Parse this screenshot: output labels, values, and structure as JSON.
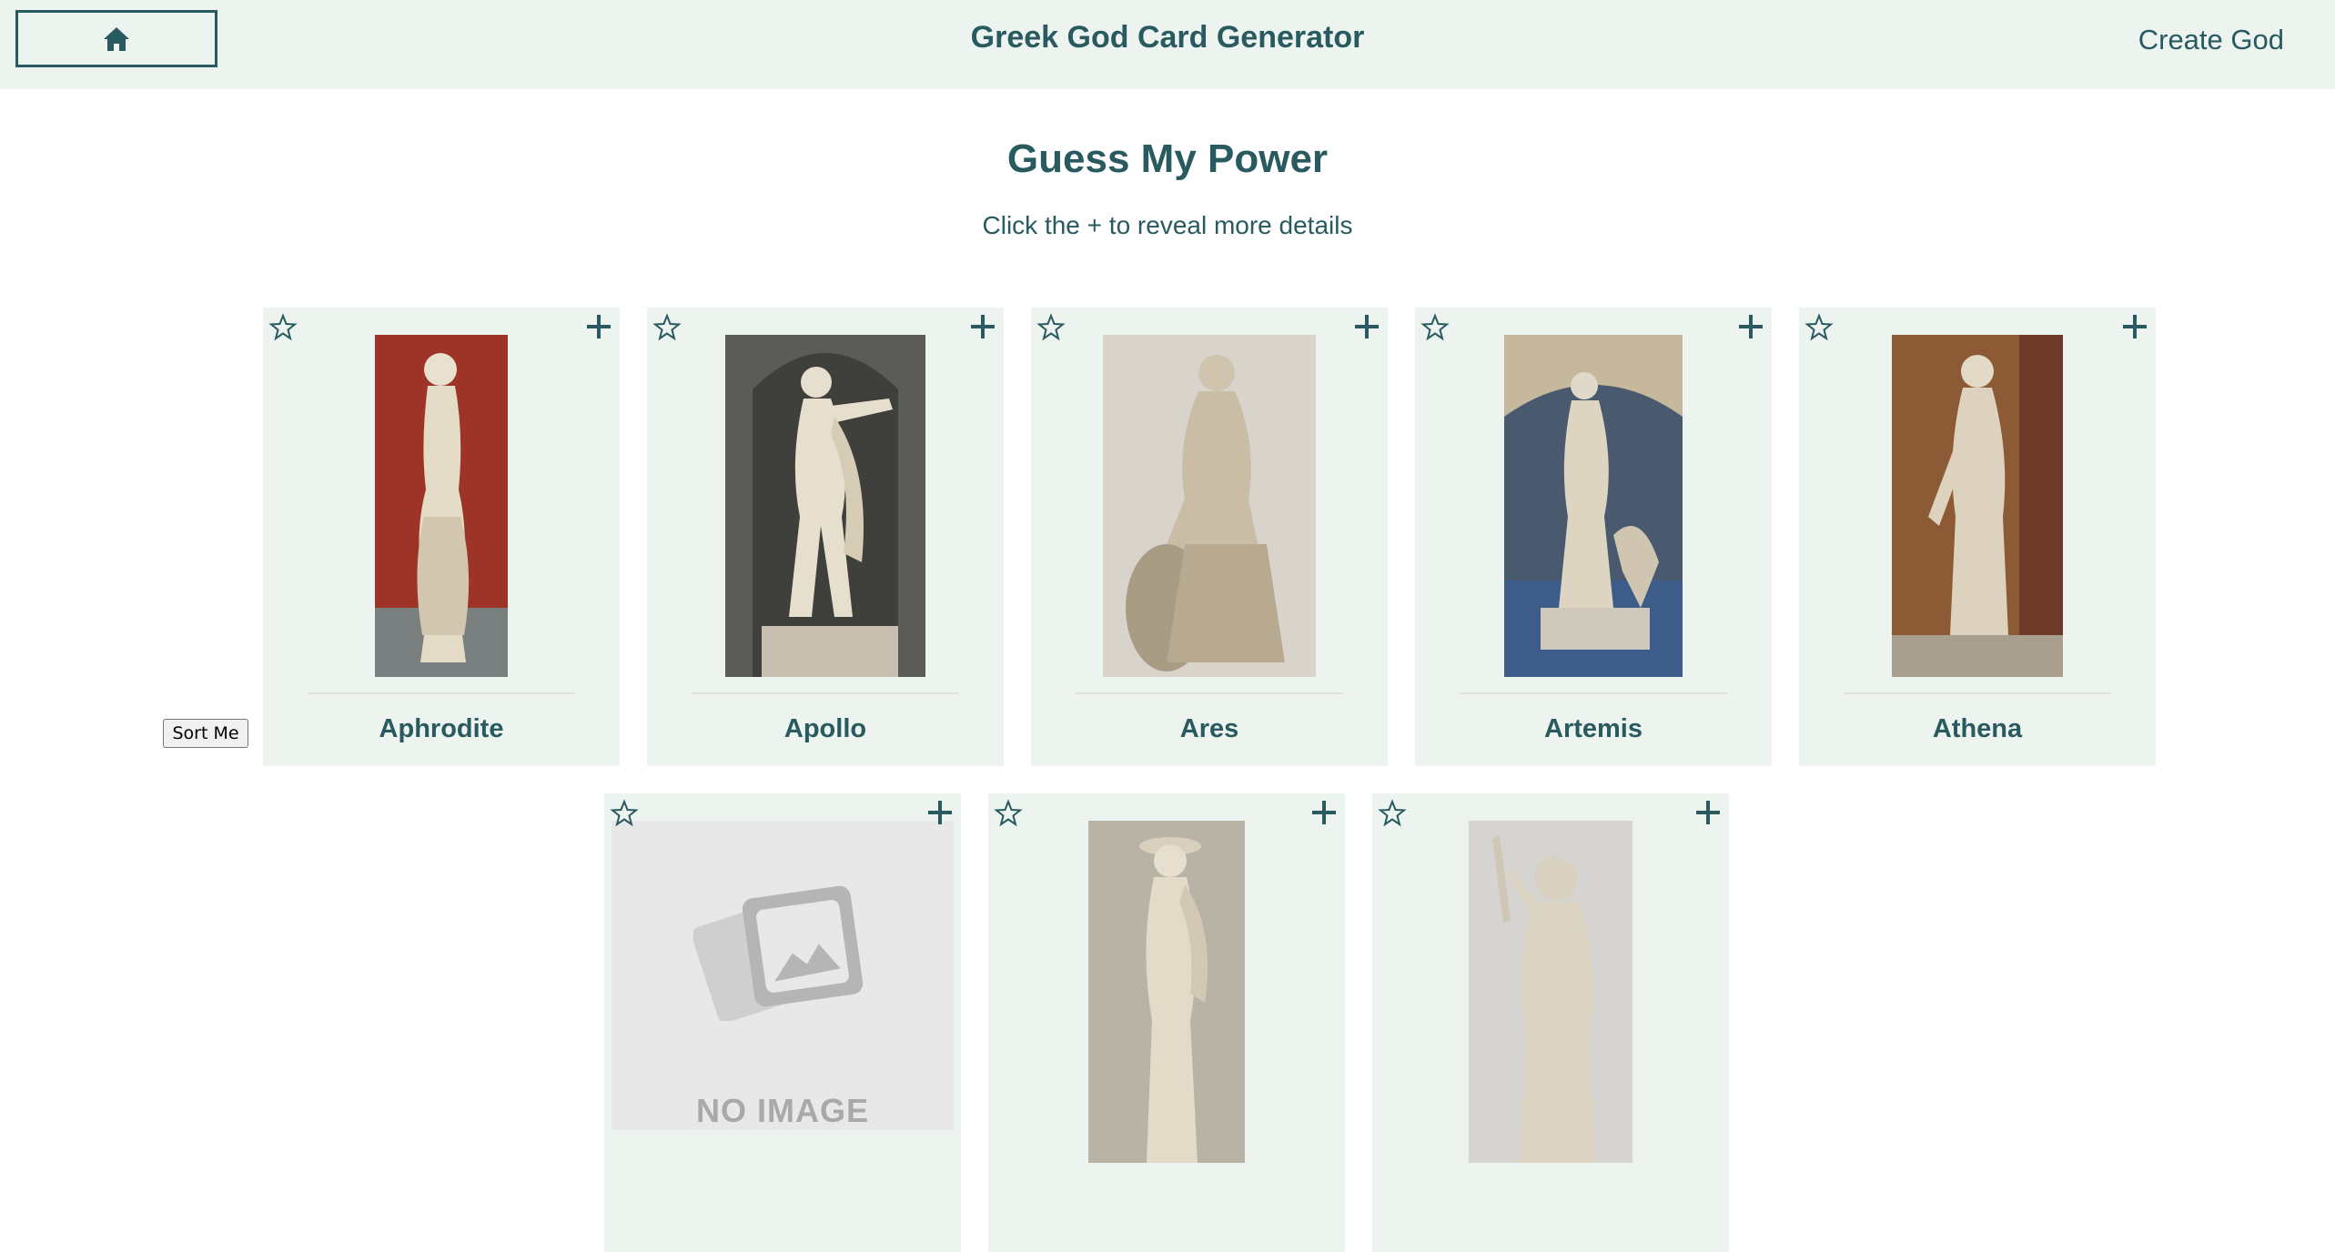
{
  "header": {
    "title": "Greek God Card Generator",
    "create_link": "Create God",
    "home_icon": "home-icon"
  },
  "main": {
    "heading": "Guess My Power",
    "subheading": "Click the + to reveal more details",
    "sort_button": "Sort Me"
  },
  "colors": {
    "primary": "#285a5f",
    "card_bg": "#edf3ee",
    "header_bg": "#edf3ee"
  },
  "cards": [
    {
      "name": "Aphrodite",
      "image": "statue-photo",
      "background": "#9d3427"
    },
    {
      "name": "Apollo",
      "image": "statue-photo",
      "background": "#5b5c58"
    },
    {
      "name": "Ares",
      "image": "statue-photo",
      "background": "#d8d4cc"
    },
    {
      "name": "Artemis",
      "image": "statue-photo",
      "background": "#4a5a6e"
    },
    {
      "name": "Athena",
      "image": "statue-photo",
      "background": "#8c5a34"
    },
    {
      "name": "",
      "image": "no-image-placeholder",
      "placeholder_text": "NO IMAGE"
    },
    {
      "name": "",
      "image": "statue-photo",
      "background": "#b9b3a6"
    },
    {
      "name": "",
      "image": "statue-photo",
      "background": "#d6d4d0"
    }
  ]
}
